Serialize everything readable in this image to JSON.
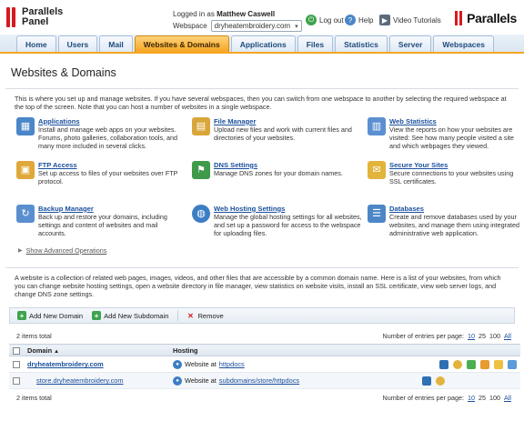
{
  "header": {
    "logo_line1": "Parallels",
    "logo_line2": "Panel",
    "logged_in_label": "Logged in as",
    "user_name": "Matthew Caswell",
    "webspace_label": "Webspace",
    "webspace_value": "dryheatembroidery.com",
    "logout": "Log out",
    "help": "Help",
    "video_tutorials": "Video Tutorials",
    "brand": "Parallels"
  },
  "tabs": [
    "Home",
    "Users",
    "Mail",
    "Websites & Domains",
    "Applications",
    "Files",
    "Statistics",
    "Server",
    "Webspaces"
  ],
  "active_tab": "Websites & Domains",
  "page": {
    "title": "Websites & Domains",
    "intro": "This is where you set up and manage websites. If you have several webspaces, then you can switch from one webspace to another by selecting the required webspace at the top of the screen. Note that you can host a number of websites in a single webspace."
  },
  "features": [
    {
      "title": "Applications",
      "desc": "Install and manage web apps on your websites. Forums, photo galleries, collaboration tools, and many more included in several clicks.",
      "icon": "applications-icon",
      "color": "#4a86c8"
    },
    {
      "title": "File Manager",
      "desc": "Upload new files and work with current files and directories of your websites.",
      "icon": "file-manager-icon",
      "color": "#d9a63a"
    },
    {
      "title": "Web Statistics",
      "desc": "View the reports on how your websites are visited: See how many people visited a site and which webpages they viewed.",
      "icon": "web-statistics-icon",
      "color": "#5b8fd1"
    },
    {
      "title": "FTP Access",
      "desc": "Set up access to files of your websites over FTP protocol.",
      "icon": "ftp-access-icon",
      "color": "#e0a83a"
    },
    {
      "title": "DNS Settings",
      "desc": "Manage DNS zones for your domain names.",
      "icon": "dns-settings-icon",
      "color": "#3f9a4a"
    },
    {
      "title": "Secure Your Sites",
      "desc": "Secure connections to your websites using SSL certificates.",
      "icon": "secure-sites-icon",
      "color": "#e2b43c"
    },
    {
      "title": "Backup Manager",
      "desc": "Back up and restore your domains, including settings and content of websites and mail accounts.",
      "icon": "backup-manager-icon",
      "color": "#5a8fcf"
    },
    {
      "title": "Web Hosting Settings",
      "desc": "Manage the global hosting settings for all websites, and set up a password for access to the webspace for uploading files.",
      "icon": "web-hosting-icon",
      "color": "#3c7ec4"
    },
    {
      "title": "Databases",
      "desc": "Create and remove databases used by your websites, and manage them using integrated administrative web application.",
      "icon": "databases-icon",
      "color": "#4d86c6"
    }
  ],
  "advanced_link": "Show Advanced Operations",
  "description": "A website is a collection of related web pages, images, videos, and other files that are accessible by a common domain name. Here is a list of your websites, from which you can change website hosting settings, open a website directory in file manager, view statistics on website visits, install an SSL certificate, view web server logs, and change DNS zone settings.",
  "toolbar": {
    "add_domain": "Add New Domain",
    "add_subdomain": "Add New Subdomain",
    "remove": "Remove"
  },
  "list": {
    "total_label": "2 items total",
    "per_page_label": "Number of entries per page:",
    "per_page_options": [
      "10",
      "25",
      "100",
      "All"
    ],
    "per_page_current": "10",
    "col_domain": "Domain",
    "sort_arrow": "▲",
    "col_hosting": "Hosting",
    "rows": [
      {
        "domain": "dryheatembroidery.com",
        "hosting_prefix": "Website at",
        "hosting_link": "httpdocs",
        "main": true
      },
      {
        "domain": "store.dryheatembroidery.com",
        "hosting_prefix": "Website at",
        "hosting_link": "subdomains/store/httpdocs",
        "main": false
      }
    ]
  }
}
